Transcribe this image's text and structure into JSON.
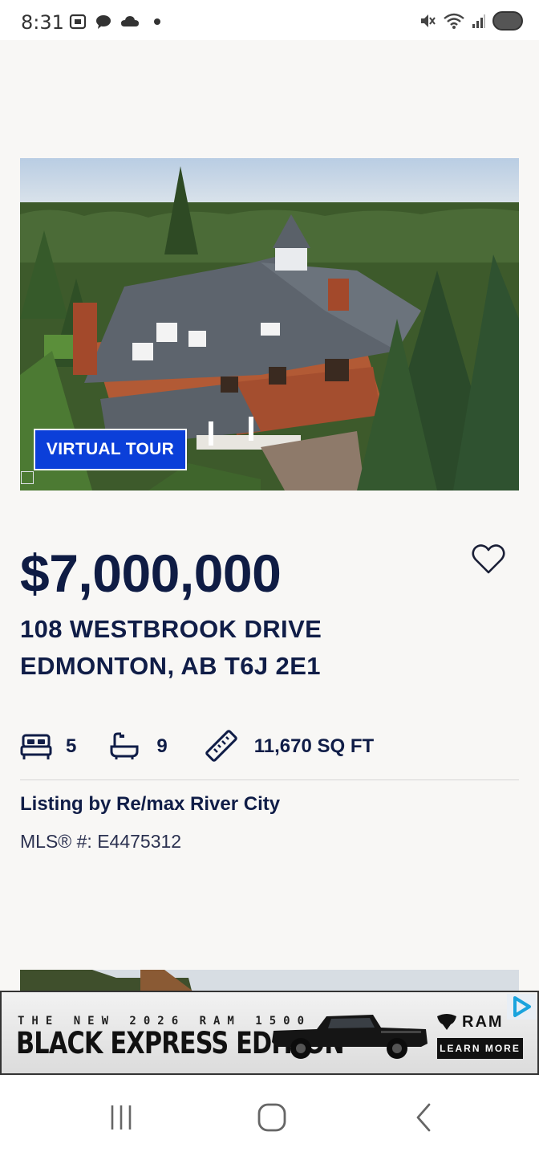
{
  "status_bar": {
    "time": "8:31"
  },
  "listing": {
    "virtual_tour_label": "VIRTUAL TOUR",
    "price": "$7,000,000",
    "address_line1": "108 WESTBROOK DRIVE",
    "address_line2": "EDMONTON, AB T6J 2E1",
    "beds": "5",
    "baths": "9",
    "area": "11,670 SQ FT",
    "listing_by": "Listing by Re/max River City",
    "mls": "MLS® #: E4475312"
  },
  "ad": {
    "line1": "THE NEW 2026 RAM 1500",
    "line2": "BLACK EXPRESS EDITION",
    "brand": "RAM",
    "cta": "LEARN MORE"
  },
  "colors": {
    "accent": "#0b3fd9",
    "text": "#101d47",
    "background": "#f8f7f5"
  }
}
